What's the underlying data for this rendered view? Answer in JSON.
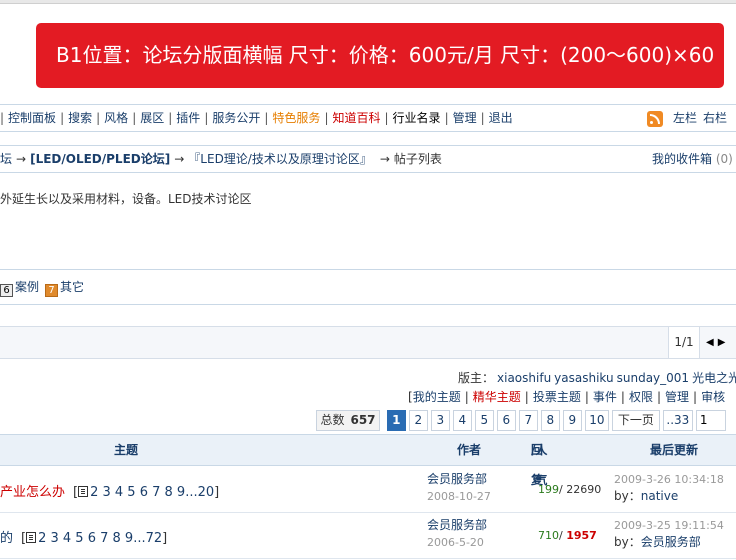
{
  "banner": {
    "text": "B1位置：论坛分版面横幅 尺寸：价格：600元/月 尺寸：(200～600)×60"
  },
  "menu": {
    "items": [
      {
        "label": "控制面板",
        "style": "normal"
      },
      {
        "label": "搜索",
        "style": "normal"
      },
      {
        "label": "风格",
        "style": "normal"
      },
      {
        "label": "展区",
        "style": "normal"
      },
      {
        "label": "插件",
        "style": "normal"
      },
      {
        "label": "服务公开",
        "style": "normal"
      },
      {
        "label": "特色服务",
        "style": "orange"
      },
      {
        "label": "知道百科",
        "style": "red"
      },
      {
        "label": "行业名录",
        "style": "black"
      },
      {
        "label": "管理",
        "style": "normal"
      },
      {
        "label": "退出",
        "style": "normal"
      }
    ],
    "layout_left": "左栏",
    "layout_right": "右栏"
  },
  "breadcrumb": {
    "part0": "坛",
    "part1": "[LED/OLED/PLED论坛]",
    "part2": "『LED理论/技术以及原理讨论区』",
    "current": "帖子列表",
    "arrow": "→",
    "inbox_label": "我的收件箱",
    "inbox_count": "(0)"
  },
  "forum_intro": "外延生长以及采用材料，设备。LED技术讨论区",
  "categories": [
    {
      "badge": "6",
      "label": "案例",
      "badge_style": "gray"
    },
    {
      "badge": "7",
      "label": "其它",
      "badge_style": "orange"
    }
  ],
  "pager_top": {
    "page": "1/1"
  },
  "moderators": {
    "label": "版主：",
    "names": [
      "xiaoshifu",
      "yasashiku",
      "sunday_001",
      "光电之光"
    ]
  },
  "actions": [
    "我的主题",
    "精华主题",
    "投票主题",
    "事件",
    "权限",
    "管理",
    "审核"
  ],
  "pages": {
    "total_label": "总数",
    "total": "657",
    "numbers": [
      "1",
      "2",
      "3",
      "4",
      "5",
      "6",
      "7",
      "8",
      "9",
      "10"
    ],
    "current": "1",
    "next": "下一页",
    "last": "..33",
    "goto_value": "1"
  },
  "table": {
    "headers": {
      "title": "主题",
      "author": "作者",
      "replies": "回复",
      "views": "人气",
      "last": "最后更新"
    },
    "rows": [
      {
        "title": "产业怎么办",
        "title_color": "red",
        "pages_text": "2 3 4 5 6 7 8 9...20",
        "author": "会员服务部",
        "date": "2008-10-27",
        "replies": "199",
        "views": "22690",
        "views_hot": false,
        "last_time": "2009-3-26 10:34:18",
        "last_by_label": "by：",
        "last_user": "native"
      },
      {
        "title": "的",
        "title_color": "blue",
        "pages_text": "2 3 4 5 6 7 8 9...72",
        "author": "会员服务部",
        "date": "2006-5-20",
        "replies": "710",
        "views": "1957",
        "views_hot": true,
        "last_time": "2009-3-25 19:11:54",
        "last_by_label": "by：",
        "last_user": "会员服务部"
      }
    ]
  },
  "colors": {
    "banner": "#e31b23",
    "link": "#1a3e6a",
    "accent_red": "#cc0000",
    "current_page": "#2a6cb3",
    "header_bg": "#eaf1f8"
  }
}
